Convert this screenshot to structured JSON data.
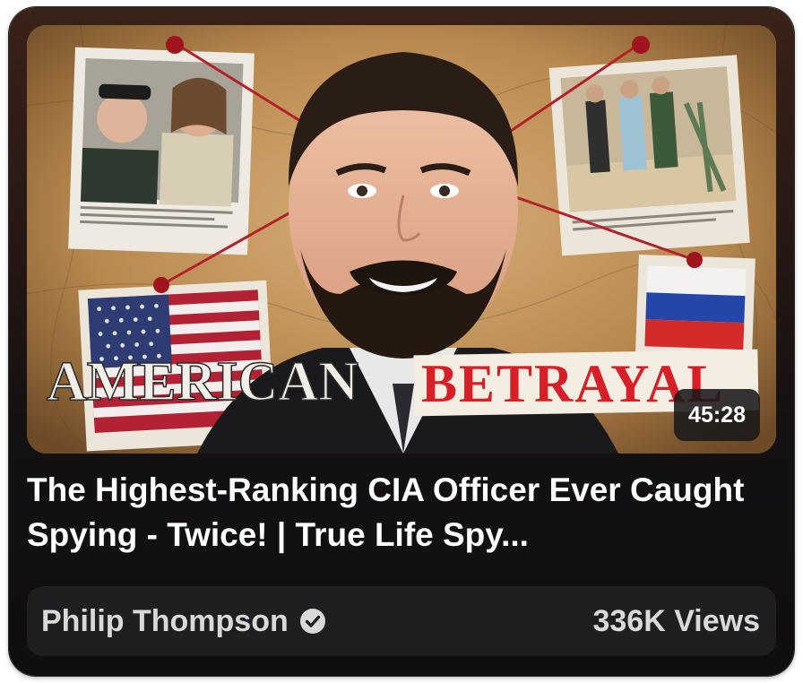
{
  "video": {
    "thumbnail_heading_left": "AMERICAN",
    "thumbnail_heading_right": "BETRAYAL",
    "duration": "45:28",
    "title": "The Highest-Ranking CIA Officer Ever Caught Spying - Twice! | True Life Spy...",
    "channel": "Philip Thompson",
    "views": "336K Views"
  },
  "icons": {
    "verified": "check-circle-icon"
  },
  "colors": {
    "card_background": "#141112",
    "meta_bar": "#1f1e21",
    "title_text": "#ffffff",
    "meta_text": "#d9d9d9",
    "heading_red": "#d61f26",
    "string_red": "#b3202a"
  }
}
